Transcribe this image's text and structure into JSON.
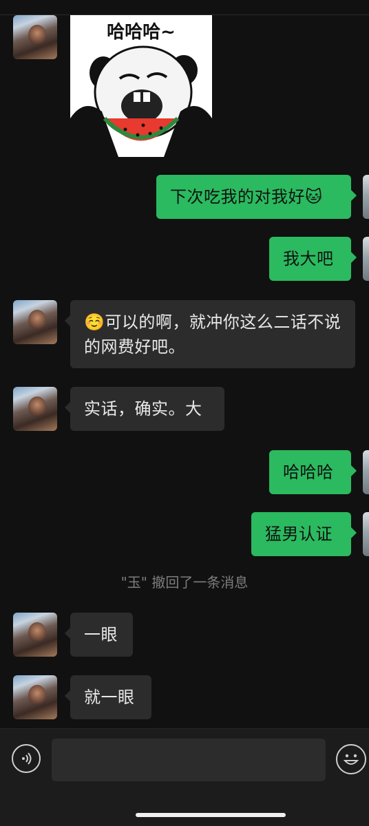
{
  "sticker": {
    "caption": "哈哈哈~"
  },
  "messages": [
    {
      "side": "right",
      "text": "下次吃我的对我好🐱"
    },
    {
      "side": "right",
      "text": "我大吧"
    },
    {
      "side": "left",
      "text": "☺️可以的啊，就冲你这么二话不说的网费好吧。"
    },
    {
      "side": "left",
      "text": "实话，确实。大"
    },
    {
      "side": "right",
      "text": "哈哈哈"
    },
    {
      "side": "right",
      "text": "猛男认证"
    },
    {
      "side": "left",
      "text": "一眼"
    },
    {
      "side": "left",
      "text": "就一眼"
    }
  ],
  "system_message": "\"玉\" 撤回了一条消息",
  "input_bar": {
    "value": "",
    "voice_icon": "voice-icon",
    "emoji_icon": "emoji-icon"
  },
  "colors": {
    "background": "#111111",
    "incoming_bubble": "#2c2c2c",
    "outgoing_bubble": "#2bba5f"
  }
}
